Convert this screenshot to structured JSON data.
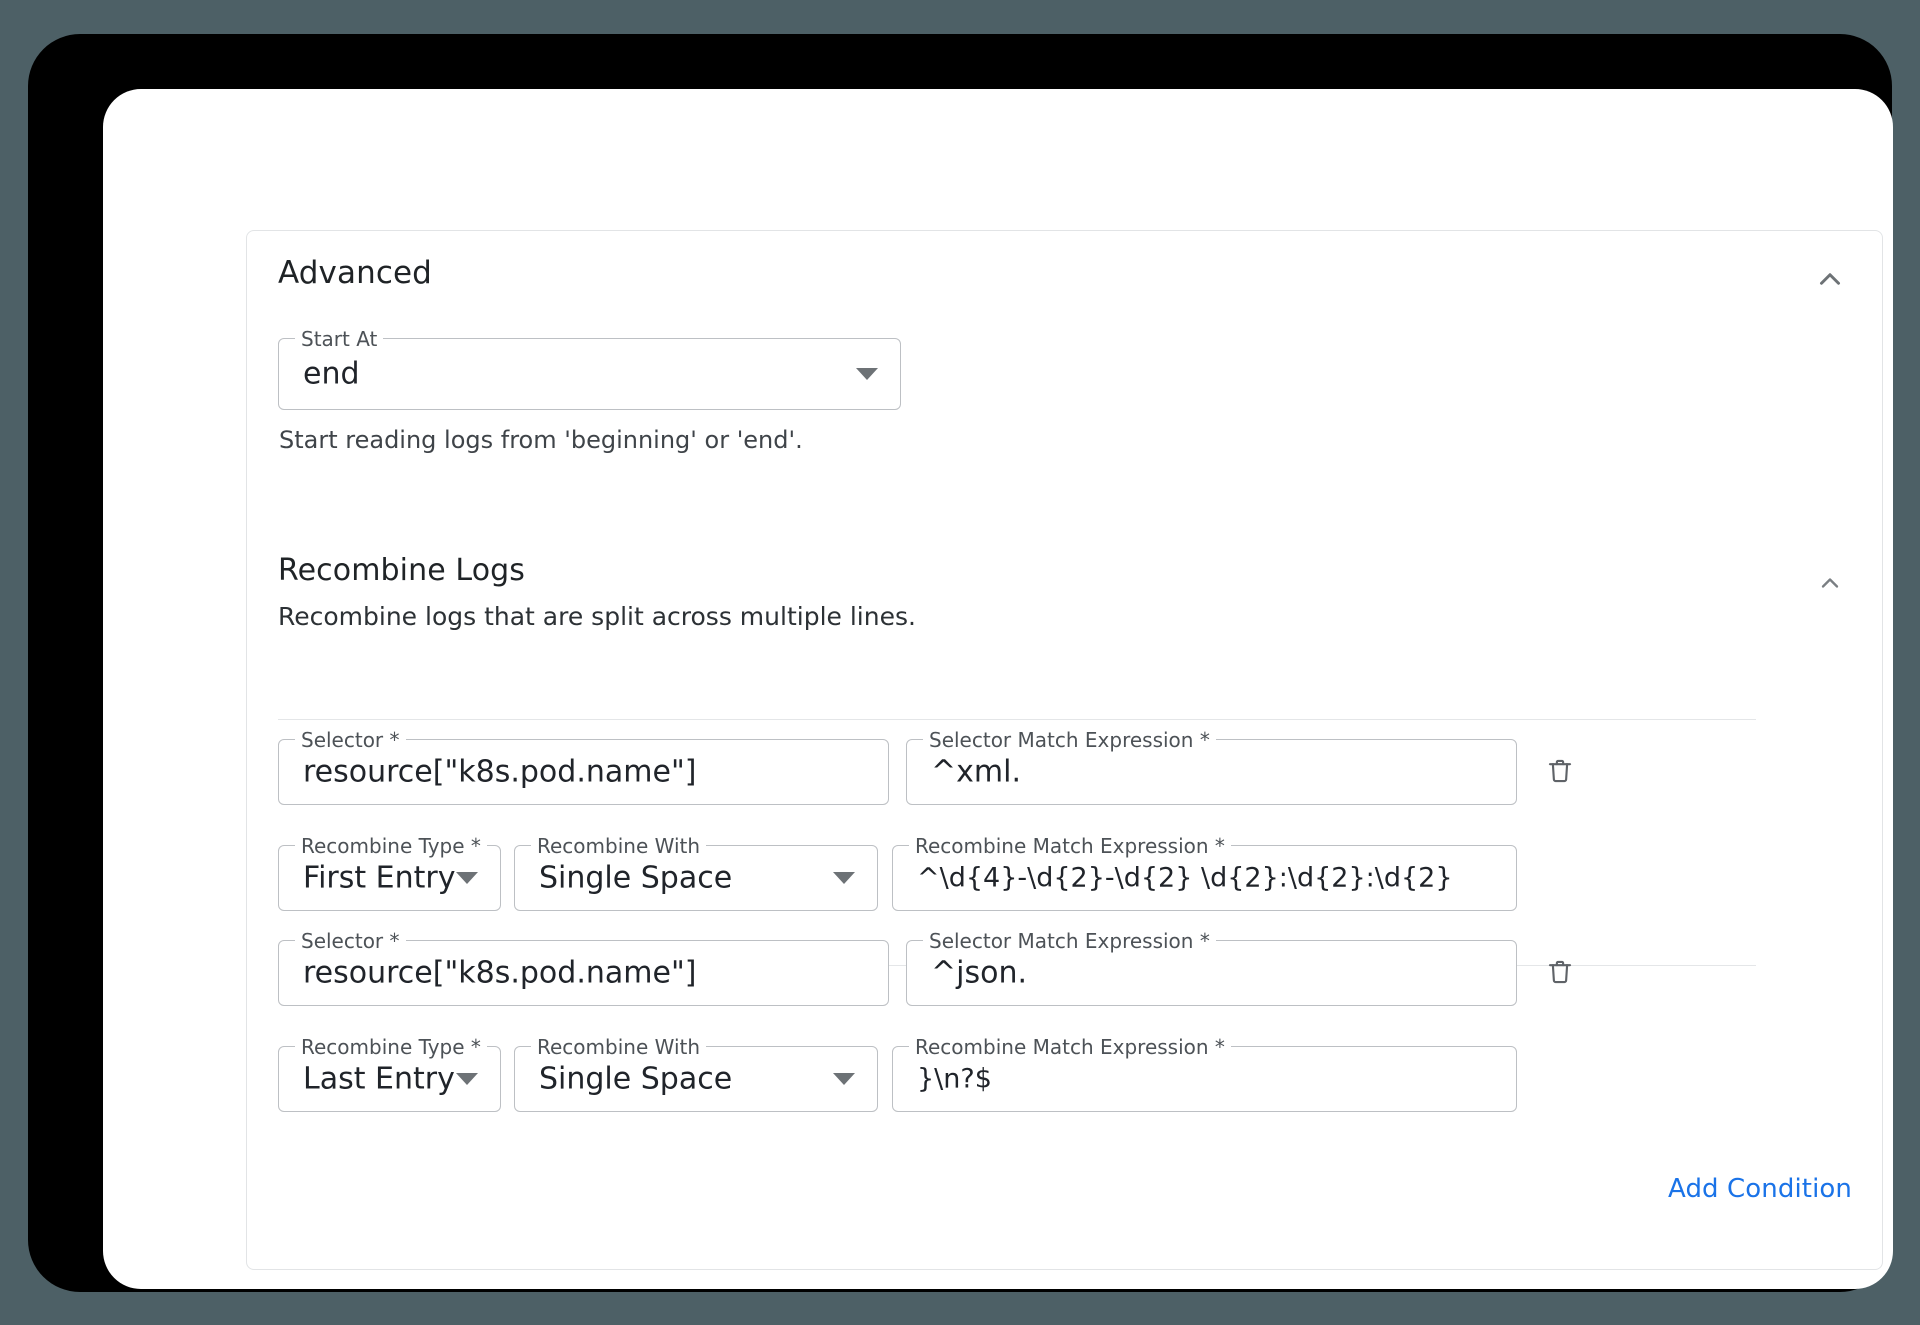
{
  "panel": {
    "title": "Advanced",
    "collapse_icon": "chevron-up-icon"
  },
  "start_at": {
    "label": "Start At",
    "value": "end",
    "helper": "Start reading logs from 'beginning' or 'end'.",
    "dropdown_icon": "chevron-down-icon"
  },
  "recombine": {
    "title": "Recombine Logs",
    "subtitle": "Recombine logs that are split across multiple lines.",
    "collapse_icon": "chevron-up-icon",
    "add_condition_label": "Add Condition",
    "delete_icon": "trash-icon",
    "labels": {
      "selector": "Selector *",
      "selector_match_expression": "Selector Match Expression *",
      "recombine_type": "Recombine Type *",
      "recombine_with": "Recombine With",
      "recombine_match_expression": "Recombine Match Expression *"
    },
    "conditions": [
      {
        "selector": "resource[\"k8s.pod.name\"]",
        "selector_match_expression": "^xml.",
        "recombine_type": "First Entry",
        "recombine_with": "Single Space",
        "recombine_match_expression": "^\\d{4}-\\d{2}-\\d{2} \\d{2}:\\d{2}:\\d{2}"
      },
      {
        "selector": "resource[\"k8s.pod.name\"]",
        "selector_match_expression": "^json.",
        "recombine_type": "Last Entry",
        "recombine_with": "Single Space",
        "recombine_match_expression": "}\\n?$"
      }
    ]
  },
  "colors": {
    "link": "#1a73e8",
    "border": "#bdc0c4",
    "text": "#1f2326",
    "backdrop": "#4d6066"
  }
}
